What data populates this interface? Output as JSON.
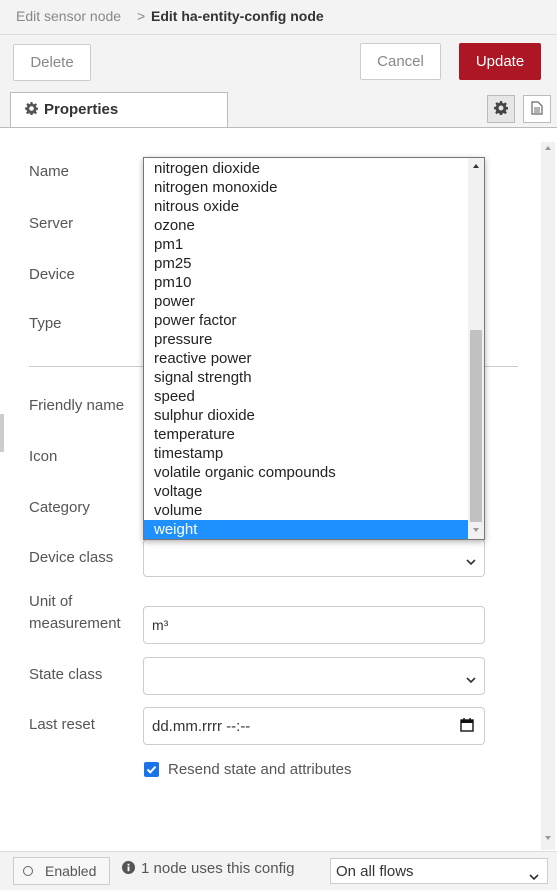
{
  "breadcrumb": {
    "parent": "Edit sensor node",
    "separator": ">",
    "current": "Edit ha-entity-config node"
  },
  "toolbar": {
    "delete_label": "Delete",
    "cancel_label": "Cancel",
    "update_label": "Update"
  },
  "tabs": {
    "properties_label": "Properties"
  },
  "form": {
    "name_label": "Name",
    "server_label": "Server",
    "device_label": "Device",
    "type_label": "Type",
    "friendly_name_label": "Friendly name",
    "icon_label": "Icon",
    "category_label": "Category",
    "device_class_label": "Device class",
    "unit_label_1": "Unit of",
    "unit_label_2": "measurement",
    "unit_value": "m³",
    "state_class_label": "State class",
    "last_reset_label": "Last reset",
    "last_reset_placeholder": "dd.mm.rrrr --:--",
    "resend_label": "Resend state and attributes",
    "resend_checked": true
  },
  "dropdown": {
    "options": [
      "nitrogen dioxide",
      "nitrogen monoxide",
      "nitrous oxide",
      "ozone",
      "pm1",
      "pm25",
      "pm10",
      "power",
      "power factor",
      "pressure",
      "reactive power",
      "signal strength",
      "speed",
      "sulphur dioxide",
      "temperature",
      "timestamp",
      "volatile organic compounds",
      "voltage",
      "volume",
      "weight"
    ],
    "selected": "weight"
  },
  "footer": {
    "enabled_label": "Enabled",
    "usage_text": "1 node uses this config",
    "scope_value": "On all flows"
  },
  "colors": {
    "accent": "#ad1625",
    "selection": "#1e90ff",
    "checkbox": "#1a73e8"
  }
}
